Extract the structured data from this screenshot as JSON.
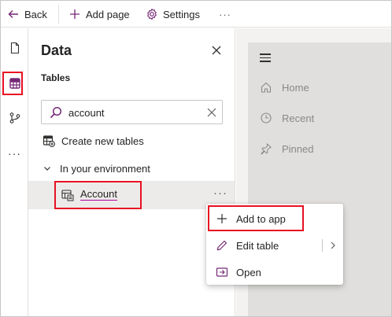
{
  "toolbar": {
    "back_label": "Back",
    "add_page_label": "Add page",
    "settings_label": "Settings",
    "more_label": "···"
  },
  "rail": {
    "items": [
      {
        "icon": "page-icon"
      },
      {
        "icon": "table-icon",
        "selected": true
      },
      {
        "icon": "branch-icon"
      },
      {
        "icon": "more-icon",
        "label": "···"
      }
    ]
  },
  "data_pane": {
    "title": "Data",
    "tables_label": "Tables",
    "search": {
      "value": "account",
      "placeholder": ""
    },
    "create_label": "Create new tables",
    "group_label": "In your environment",
    "table_item": "Account",
    "more_label": "···"
  },
  "canvas": {
    "nav_items": [
      {
        "label": "Home",
        "icon": "home-icon"
      },
      {
        "label": "Recent",
        "icon": "clock-icon"
      },
      {
        "label": "Pinned",
        "icon": "pin-icon"
      }
    ]
  },
  "context_menu": {
    "items": [
      {
        "label": "Add to app",
        "icon": "plus-icon"
      },
      {
        "label": "Edit table",
        "icon": "pencil-icon"
      },
      {
        "label": "Open",
        "icon": "open-icon"
      }
    ]
  },
  "colors": {
    "accent": "#742774",
    "highlight": "#e81123",
    "selected_row": "#edebe9",
    "canvas_bg": "#f3f2f1",
    "preview_bg": "#e1dfdd"
  }
}
